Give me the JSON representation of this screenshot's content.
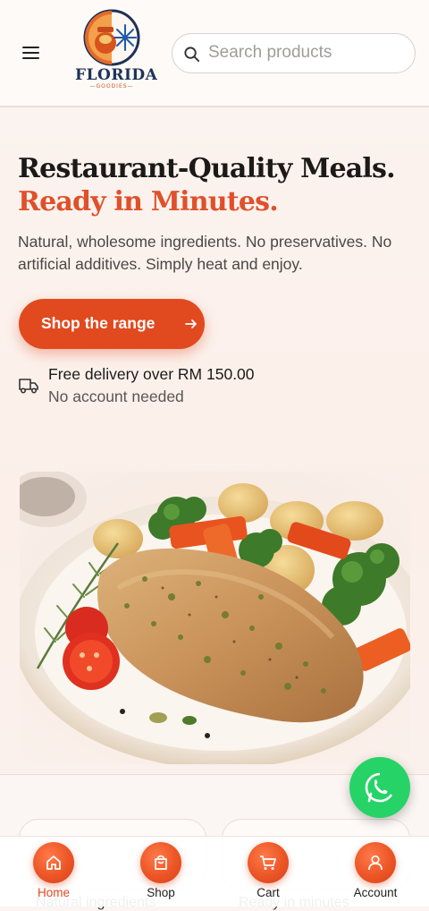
{
  "header": {
    "logo_text": "FLORIDA",
    "logo_subtext": "GOODIES",
    "search_placeholder": "Search products"
  },
  "hero": {
    "headline_line1": "Restaurant-Quality Meals.",
    "headline_line2": "Ready in Minutes.",
    "lead": "Natural, wholesome ingredients. No preservatives. No artificial additives. Simply heat and enjoy.",
    "cta_label": "Shop the range",
    "delivery_title": "Free delivery over RM 150.00",
    "delivery_subtitle": "No account needed"
  },
  "features": [
    {
      "label": "Natural ingredients"
    },
    {
      "label": "Ready in minutes"
    }
  ],
  "bottom_nav": {
    "items": [
      {
        "label": "Home",
        "icon": "home-icon",
        "active": true
      },
      {
        "label": "Shop",
        "icon": "shopping-bag-icon",
        "active": false
      },
      {
        "label": "Cart",
        "icon": "cart-icon",
        "active": false
      },
      {
        "label": "Account",
        "icon": "user-icon",
        "active": false
      }
    ]
  },
  "colors": {
    "accent": "#e14a1f",
    "whatsapp": "#25d366",
    "navy": "#1f3256"
  }
}
